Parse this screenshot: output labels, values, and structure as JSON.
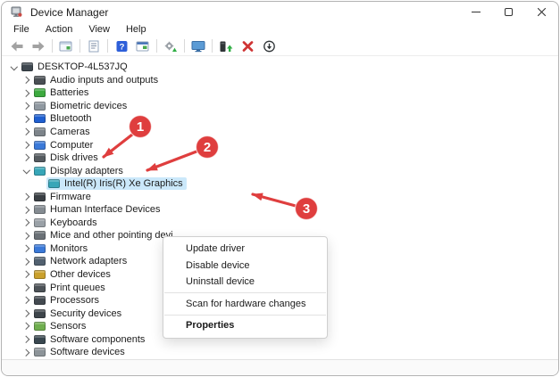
{
  "window": {
    "title": "Device Manager",
    "controls": {
      "minimize": "minimize",
      "maximize": "maximize",
      "close": "close"
    }
  },
  "colors": {
    "annotation_red": "#df3e3e",
    "selection_blue": "#cbe8fa",
    "help_blue": "#2e5fd9",
    "uninstall_red": "#cf3434",
    "success_green": "#2fae44"
  },
  "menu_bar": {
    "items": [
      "File",
      "Action",
      "View",
      "Help"
    ]
  },
  "toolbar": {
    "icons": [
      "back-icon",
      "forward-icon",
      "console-tree-icon",
      "properties-icon",
      "help-icon",
      "list-panel-icon",
      "update-settings-icon",
      "scan-monitor-icon",
      "driver-update-icon",
      "uninstall-x-icon",
      "disable-down-icon"
    ]
  },
  "tree": {
    "items": [
      {
        "label": "DESKTOP-4L537JQ",
        "level": 0,
        "state": "expanded",
        "icon": "computer-icon",
        "icon_color": "#3f4850",
        "selected": false
      },
      {
        "label": "Audio inputs and outputs",
        "level": 1,
        "state": "collapsed",
        "icon": "speaker-icon",
        "icon_color": "#4a4f54",
        "selected": false
      },
      {
        "label": "Batteries",
        "level": 1,
        "state": "collapsed",
        "icon": "battery-icon",
        "icon_color": "#3daa3f",
        "selected": false
      },
      {
        "label": "Biometric devices",
        "level": 1,
        "state": "collapsed",
        "icon": "fingerprint-icon",
        "icon_color": "#9099a1",
        "selected": false
      },
      {
        "label": "Bluetooth",
        "level": 1,
        "state": "collapsed",
        "icon": "bluetooth-icon",
        "icon_color": "#1f5fd0",
        "selected": false
      },
      {
        "label": "Cameras",
        "level": 1,
        "state": "collapsed",
        "icon": "camera-icon",
        "icon_color": "#7d848a",
        "selected": false
      },
      {
        "label": "Computer",
        "level": 1,
        "state": "collapsed",
        "icon": "monitor-icon",
        "icon_color": "#3a79d8",
        "selected": false
      },
      {
        "label": "Disk drives",
        "level": 1,
        "state": "collapsed",
        "icon": "disk-icon",
        "icon_color": "#555b60",
        "selected": false
      },
      {
        "label": "Display adapters",
        "level": 1,
        "state": "expanded",
        "icon": "display-adapter-icon",
        "icon_color": "#37a6b8",
        "selected": false
      },
      {
        "label": "Intel(R) Iris(R) Xe Graphics",
        "level": 2,
        "state": null,
        "icon": "display-adapter-icon",
        "icon_color": "#37a6b8",
        "selected": true
      },
      {
        "label": "Firmware",
        "level": 1,
        "state": "collapsed",
        "icon": "chip-icon",
        "icon_color": "#3a3f44",
        "selected": false
      },
      {
        "label": "Human Interface Devices",
        "level": 1,
        "state": "collapsed",
        "icon": "hid-icon",
        "icon_color": "#858c92",
        "selected": false
      },
      {
        "label": "Keyboards",
        "level": 1,
        "state": "collapsed",
        "icon": "keyboard-icon",
        "icon_color": "#9aa1a7",
        "selected": false
      },
      {
        "label": "Mice and other pointing devi",
        "level": 1,
        "state": "collapsed",
        "icon": "mouse-icon",
        "icon_color": "#6b7177",
        "selected": false
      },
      {
        "label": "Monitors",
        "level": 1,
        "state": "collapsed",
        "icon": "monitor-icon",
        "icon_color": "#3a79d8",
        "selected": false
      },
      {
        "label": "Network adapters",
        "level": 1,
        "state": "collapsed",
        "icon": "network-adapter-icon",
        "icon_color": "#51606f",
        "selected": false
      },
      {
        "label": "Other devices",
        "level": 1,
        "state": "collapsed",
        "icon": "unknown-device-icon",
        "icon_color": "#caa02c",
        "selected": false
      },
      {
        "label": "Print queues",
        "level": 1,
        "state": "collapsed",
        "icon": "printer-icon",
        "icon_color": "#4d5358",
        "selected": false
      },
      {
        "label": "Processors",
        "level": 1,
        "state": "collapsed",
        "icon": "cpu-icon",
        "icon_color": "#434a50",
        "selected": false
      },
      {
        "label": "Security devices",
        "level": 1,
        "state": "collapsed",
        "icon": "security-device-icon",
        "icon_color": "#3e454b",
        "selected": false
      },
      {
        "label": "Sensors",
        "level": 1,
        "state": "collapsed",
        "icon": "sensor-icon",
        "icon_color": "#6fae4e",
        "selected": false
      },
      {
        "label": "Software components",
        "level": 1,
        "state": "collapsed",
        "icon": "software-component-icon",
        "icon_color": "#39474f",
        "selected": false
      },
      {
        "label": "Software devices",
        "level": 1,
        "state": "collapsed",
        "icon": "software-device-icon",
        "icon_color": "#8d9499",
        "selected": false
      }
    ]
  },
  "context_menu": {
    "items": [
      {
        "label": "Update driver"
      },
      {
        "label": "Disable device"
      },
      {
        "label": "Uninstall device"
      },
      {
        "type": "separator"
      },
      {
        "label": "Scan for hardware changes"
      },
      {
        "type": "separator"
      },
      {
        "label": "Properties",
        "bold": true
      }
    ]
  },
  "annotations": {
    "steps": [
      {
        "number": "1"
      },
      {
        "number": "2"
      },
      {
        "number": "3"
      }
    ]
  }
}
